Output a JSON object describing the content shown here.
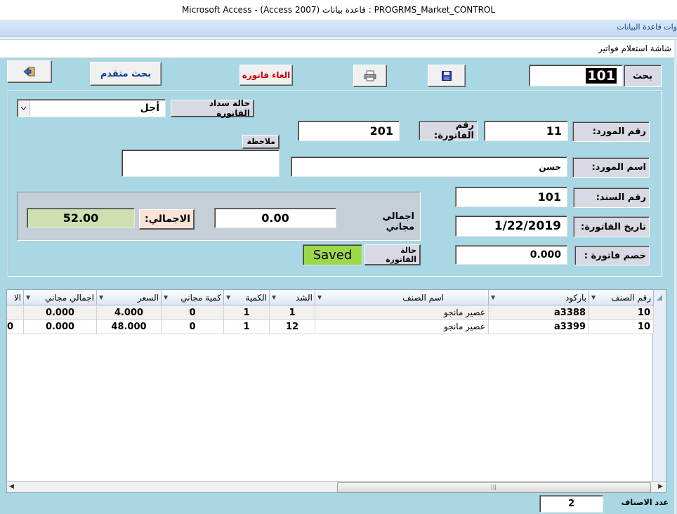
{
  "window": {
    "title": "Microsoft Access - (Access 2007) قاعدة بيانات : PROGRMS_Market_CONTROL"
  },
  "ribbon": {
    "label": "وات قاعدة البيانات"
  },
  "form": {
    "tab_label": "شاشة استعلام فواتير"
  },
  "toolbar": {
    "search_label": "بحث",
    "search_value": "101",
    "cancel_label": "الغاء فاتورة",
    "advanced_label": "بحث متقدم"
  },
  "invoice": {
    "payment_status_label": "حالة سداد الفاتورة",
    "payment_status_value": "أجل",
    "supplier_no_label": "رقم المورد:",
    "supplier_no_value": "11",
    "invoice_no_label": "رقم الفاتورة:",
    "invoice_no_value": "201",
    "note_label": "ملاحظة",
    "note_value": "",
    "supplier_name_label": "اسم المورد:",
    "supplier_name_value": "حسن",
    "voucher_no_label": "رقم السند:",
    "voucher_no_value": "101",
    "invoice_date_label": "تاريخ الفاتورة:",
    "invoice_date_value": "1/22/2019",
    "discount_label": "خصم فاتورة :",
    "discount_value": "0.000",
    "free_total_label": "اجمالي مجاني",
    "free_total_value": "0.00",
    "total_label": "الاجمالي:",
    "total_value": "52.00",
    "invoice_status_label": "حالة الفاتورة",
    "invoice_status_value": "Saved"
  },
  "grid": {
    "columns": [
      "رقم الصنف",
      "باركود",
      "اسم الصنف",
      "الشد",
      "الكمية",
      "كمية مجاني",
      "السعر",
      "اجمالي مجاني",
      "الا"
    ],
    "rows": [
      {
        "item_no": "10",
        "barcode": "a3388",
        "name": "عصير مانجو",
        "pack": "1",
        "qty": "1",
        "free_qty": "0",
        "price": "4.000",
        "free_total": "0.000",
        "extra": ""
      },
      {
        "item_no": "10",
        "barcode": "a3399",
        "name": "عصير مانجو",
        "pack": "12",
        "qty": "1",
        "free_qty": "0",
        "price": "48.000",
        "free_total": "0.000",
        "extra": "0"
      }
    ]
  },
  "footer": {
    "count_label": "عدد الاصناف",
    "count_value": "2"
  },
  "colors": {
    "background": "#a9d7e3",
    "saved_badge": "#9bd84c",
    "total_field": "#cfe0b0",
    "cancel_text": "#d40000",
    "advanced_text": "#0a3d91"
  },
  "icons": [
    "exit-icon",
    "print-icon",
    "save-icon",
    "dropdown-chevron-icon"
  ]
}
